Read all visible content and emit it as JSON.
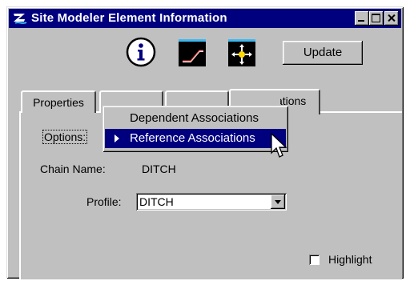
{
  "window": {
    "title": "Site Modeler Element Information"
  },
  "toolbar": {
    "update_label": "Update"
  },
  "tabs": [
    "Properties",
    "",
    "",
    "Associations"
  ],
  "menu": {
    "items": [
      "Dependent Associations",
      "Reference Associations"
    ],
    "selected": "Reference Associations"
  },
  "panel": {
    "options_label": "Options:",
    "chain_label": "Chain Name:",
    "chain_value": "DITCH",
    "profile_label": "Profile:",
    "profile_value": "DITCH",
    "highlight_label": "Highlight",
    "highlight_checked": false
  },
  "icons": {
    "app": "site-modeler-logo-icon",
    "info": "info-icon",
    "profile": "profile-view-icon",
    "pan": "pan-arrows-icon"
  }
}
